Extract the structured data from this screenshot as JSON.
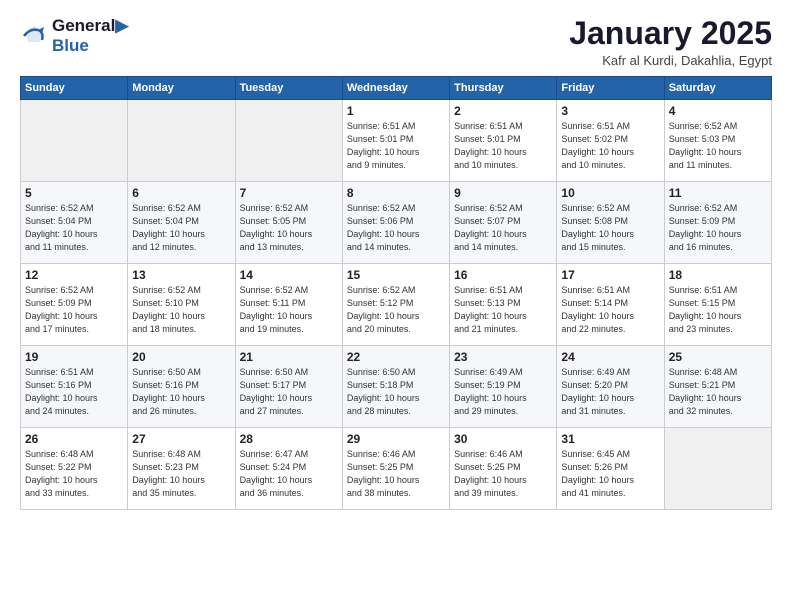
{
  "header": {
    "logo_line1": "General",
    "logo_line2": "Blue",
    "title": "January 2025",
    "location": "Kafr al Kurdi, Dakahlia, Egypt"
  },
  "weekdays": [
    "Sunday",
    "Monday",
    "Tuesday",
    "Wednesday",
    "Thursday",
    "Friday",
    "Saturday"
  ],
  "weeks": [
    [
      {
        "day": "",
        "content": ""
      },
      {
        "day": "",
        "content": ""
      },
      {
        "day": "",
        "content": ""
      },
      {
        "day": "1",
        "content": "Sunrise: 6:51 AM\nSunset: 5:01 PM\nDaylight: 10 hours\nand 9 minutes."
      },
      {
        "day": "2",
        "content": "Sunrise: 6:51 AM\nSunset: 5:01 PM\nDaylight: 10 hours\nand 10 minutes."
      },
      {
        "day": "3",
        "content": "Sunrise: 6:51 AM\nSunset: 5:02 PM\nDaylight: 10 hours\nand 10 minutes."
      },
      {
        "day": "4",
        "content": "Sunrise: 6:52 AM\nSunset: 5:03 PM\nDaylight: 10 hours\nand 11 minutes."
      }
    ],
    [
      {
        "day": "5",
        "content": "Sunrise: 6:52 AM\nSunset: 5:04 PM\nDaylight: 10 hours\nand 11 minutes."
      },
      {
        "day": "6",
        "content": "Sunrise: 6:52 AM\nSunset: 5:04 PM\nDaylight: 10 hours\nand 12 minutes."
      },
      {
        "day": "7",
        "content": "Sunrise: 6:52 AM\nSunset: 5:05 PM\nDaylight: 10 hours\nand 13 minutes."
      },
      {
        "day": "8",
        "content": "Sunrise: 6:52 AM\nSunset: 5:06 PM\nDaylight: 10 hours\nand 14 minutes."
      },
      {
        "day": "9",
        "content": "Sunrise: 6:52 AM\nSunset: 5:07 PM\nDaylight: 10 hours\nand 14 minutes."
      },
      {
        "day": "10",
        "content": "Sunrise: 6:52 AM\nSunset: 5:08 PM\nDaylight: 10 hours\nand 15 minutes."
      },
      {
        "day": "11",
        "content": "Sunrise: 6:52 AM\nSunset: 5:09 PM\nDaylight: 10 hours\nand 16 minutes."
      }
    ],
    [
      {
        "day": "12",
        "content": "Sunrise: 6:52 AM\nSunset: 5:09 PM\nDaylight: 10 hours\nand 17 minutes."
      },
      {
        "day": "13",
        "content": "Sunrise: 6:52 AM\nSunset: 5:10 PM\nDaylight: 10 hours\nand 18 minutes."
      },
      {
        "day": "14",
        "content": "Sunrise: 6:52 AM\nSunset: 5:11 PM\nDaylight: 10 hours\nand 19 minutes."
      },
      {
        "day": "15",
        "content": "Sunrise: 6:52 AM\nSunset: 5:12 PM\nDaylight: 10 hours\nand 20 minutes."
      },
      {
        "day": "16",
        "content": "Sunrise: 6:51 AM\nSunset: 5:13 PM\nDaylight: 10 hours\nand 21 minutes."
      },
      {
        "day": "17",
        "content": "Sunrise: 6:51 AM\nSunset: 5:14 PM\nDaylight: 10 hours\nand 22 minutes."
      },
      {
        "day": "18",
        "content": "Sunrise: 6:51 AM\nSunset: 5:15 PM\nDaylight: 10 hours\nand 23 minutes."
      }
    ],
    [
      {
        "day": "19",
        "content": "Sunrise: 6:51 AM\nSunset: 5:16 PM\nDaylight: 10 hours\nand 24 minutes."
      },
      {
        "day": "20",
        "content": "Sunrise: 6:50 AM\nSunset: 5:16 PM\nDaylight: 10 hours\nand 26 minutes."
      },
      {
        "day": "21",
        "content": "Sunrise: 6:50 AM\nSunset: 5:17 PM\nDaylight: 10 hours\nand 27 minutes."
      },
      {
        "day": "22",
        "content": "Sunrise: 6:50 AM\nSunset: 5:18 PM\nDaylight: 10 hours\nand 28 minutes."
      },
      {
        "day": "23",
        "content": "Sunrise: 6:49 AM\nSunset: 5:19 PM\nDaylight: 10 hours\nand 29 minutes."
      },
      {
        "day": "24",
        "content": "Sunrise: 6:49 AM\nSunset: 5:20 PM\nDaylight: 10 hours\nand 31 minutes."
      },
      {
        "day": "25",
        "content": "Sunrise: 6:48 AM\nSunset: 5:21 PM\nDaylight: 10 hours\nand 32 minutes."
      }
    ],
    [
      {
        "day": "26",
        "content": "Sunrise: 6:48 AM\nSunset: 5:22 PM\nDaylight: 10 hours\nand 33 minutes."
      },
      {
        "day": "27",
        "content": "Sunrise: 6:48 AM\nSunset: 5:23 PM\nDaylight: 10 hours\nand 35 minutes."
      },
      {
        "day": "28",
        "content": "Sunrise: 6:47 AM\nSunset: 5:24 PM\nDaylight: 10 hours\nand 36 minutes."
      },
      {
        "day": "29",
        "content": "Sunrise: 6:46 AM\nSunset: 5:25 PM\nDaylight: 10 hours\nand 38 minutes."
      },
      {
        "day": "30",
        "content": "Sunrise: 6:46 AM\nSunset: 5:25 PM\nDaylight: 10 hours\nand 39 minutes."
      },
      {
        "day": "31",
        "content": "Sunrise: 6:45 AM\nSunset: 5:26 PM\nDaylight: 10 hours\nand 41 minutes."
      },
      {
        "day": "",
        "content": ""
      }
    ]
  ]
}
